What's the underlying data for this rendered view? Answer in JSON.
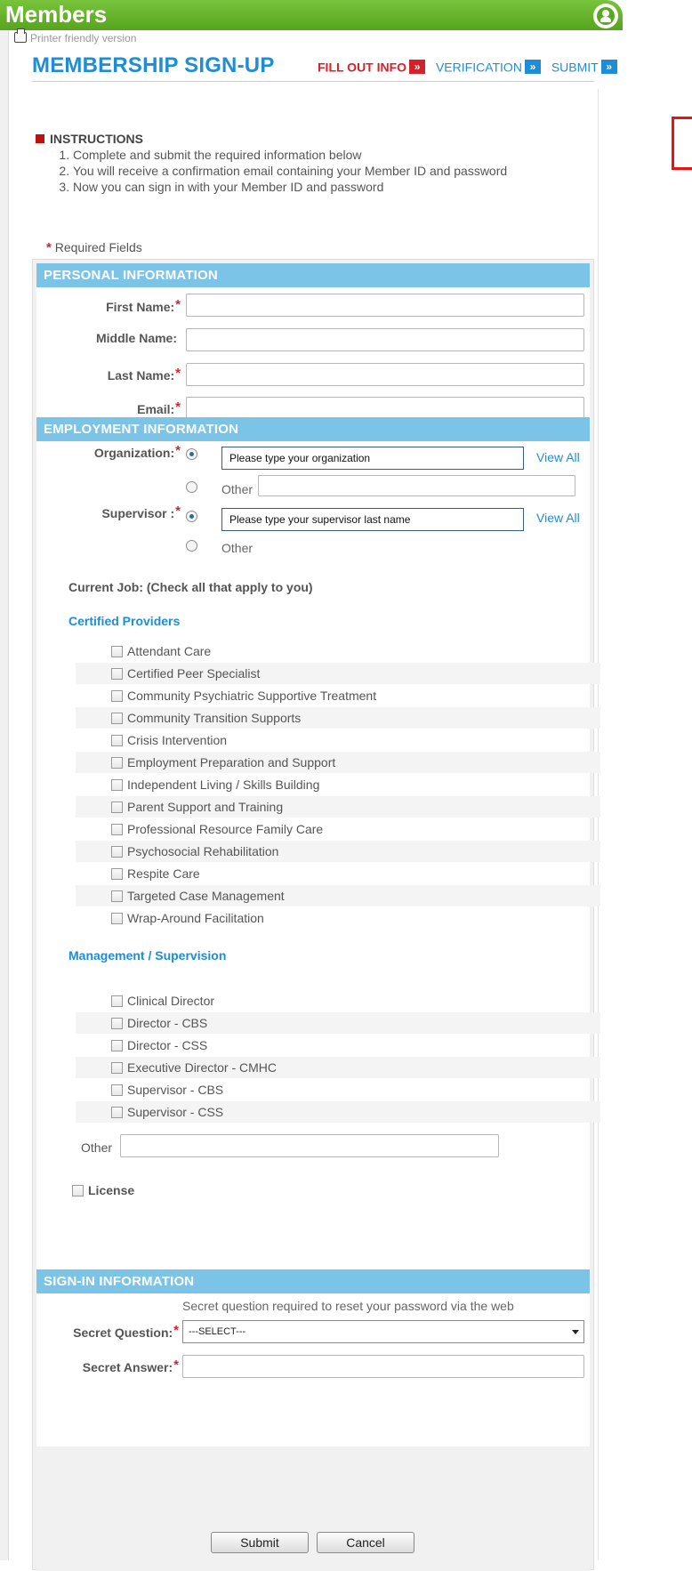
{
  "header": {
    "title": "Members"
  },
  "printer": {
    "label": "Printer friendly version"
  },
  "signup": {
    "title": "MEMBERSHIP SIGN-UP",
    "steps": [
      "FILL OUT INFO",
      "VERIFICATION",
      "SUBMIT"
    ]
  },
  "instructions": {
    "heading": "INSTRUCTIONS",
    "items": [
      "Complete and submit the required information below",
      "You will receive a confirmation email containing your Member ID and password",
      "Now you can sign in with your Member ID and password"
    ]
  },
  "required_note": "Required Fields",
  "personal": {
    "heading": "PERSONAL INFORMATION",
    "first_name": "First Name:",
    "middle_name": "Middle Name:",
    "last_name": "Last Name:",
    "email": "Email:"
  },
  "employment": {
    "heading": "EMPLOYMENT INFORMATION",
    "organization_label": "Organization:",
    "organization_value": "Please type your organization",
    "supervisor_label": "Supervisor :",
    "supervisor_value": "Please type your supervisor last name",
    "view_all": "View All",
    "other": "Other",
    "current_job": "Current Job: (Check all that apply to you)",
    "certified_heading": "Certified Providers",
    "certified_items": [
      "Attendant Care",
      "Certified Peer Specialist",
      "Community Psychiatric Supportive Treatment",
      "Community Transition Supports",
      "Crisis Intervention",
      "Employment Preparation and Support",
      "Independent Living / Skills Building",
      "Parent Support and Training",
      "Professional Resource Family Care",
      "Psychosocial Rehabilitation",
      "Respite Care",
      "Targeted Case Management",
      "Wrap-Around Facilitation"
    ],
    "management_heading": "Management / Supervision",
    "management_items": [
      "Clinical Director",
      "Director - CBS",
      "Director - CSS",
      "Executive Director - CMHC",
      "Supervisor - CBS",
      "Supervisor - CSS"
    ],
    "other_label": "Other",
    "license_label": "License"
  },
  "signin": {
    "heading": "SIGN-IN INFORMATION",
    "note": "Secret question required to reset your password via the web",
    "question_label": "Secret Question:",
    "question_value": "---SELECT---",
    "answer_label": "Secret Answer:"
  },
  "buttons": {
    "submit": "Submit",
    "cancel": "Cancel"
  },
  "colors": {
    "green": "#5aa81e",
    "blue": "#1f8dd6",
    "section": "#7cc3e8",
    "red": "#d2232a"
  }
}
